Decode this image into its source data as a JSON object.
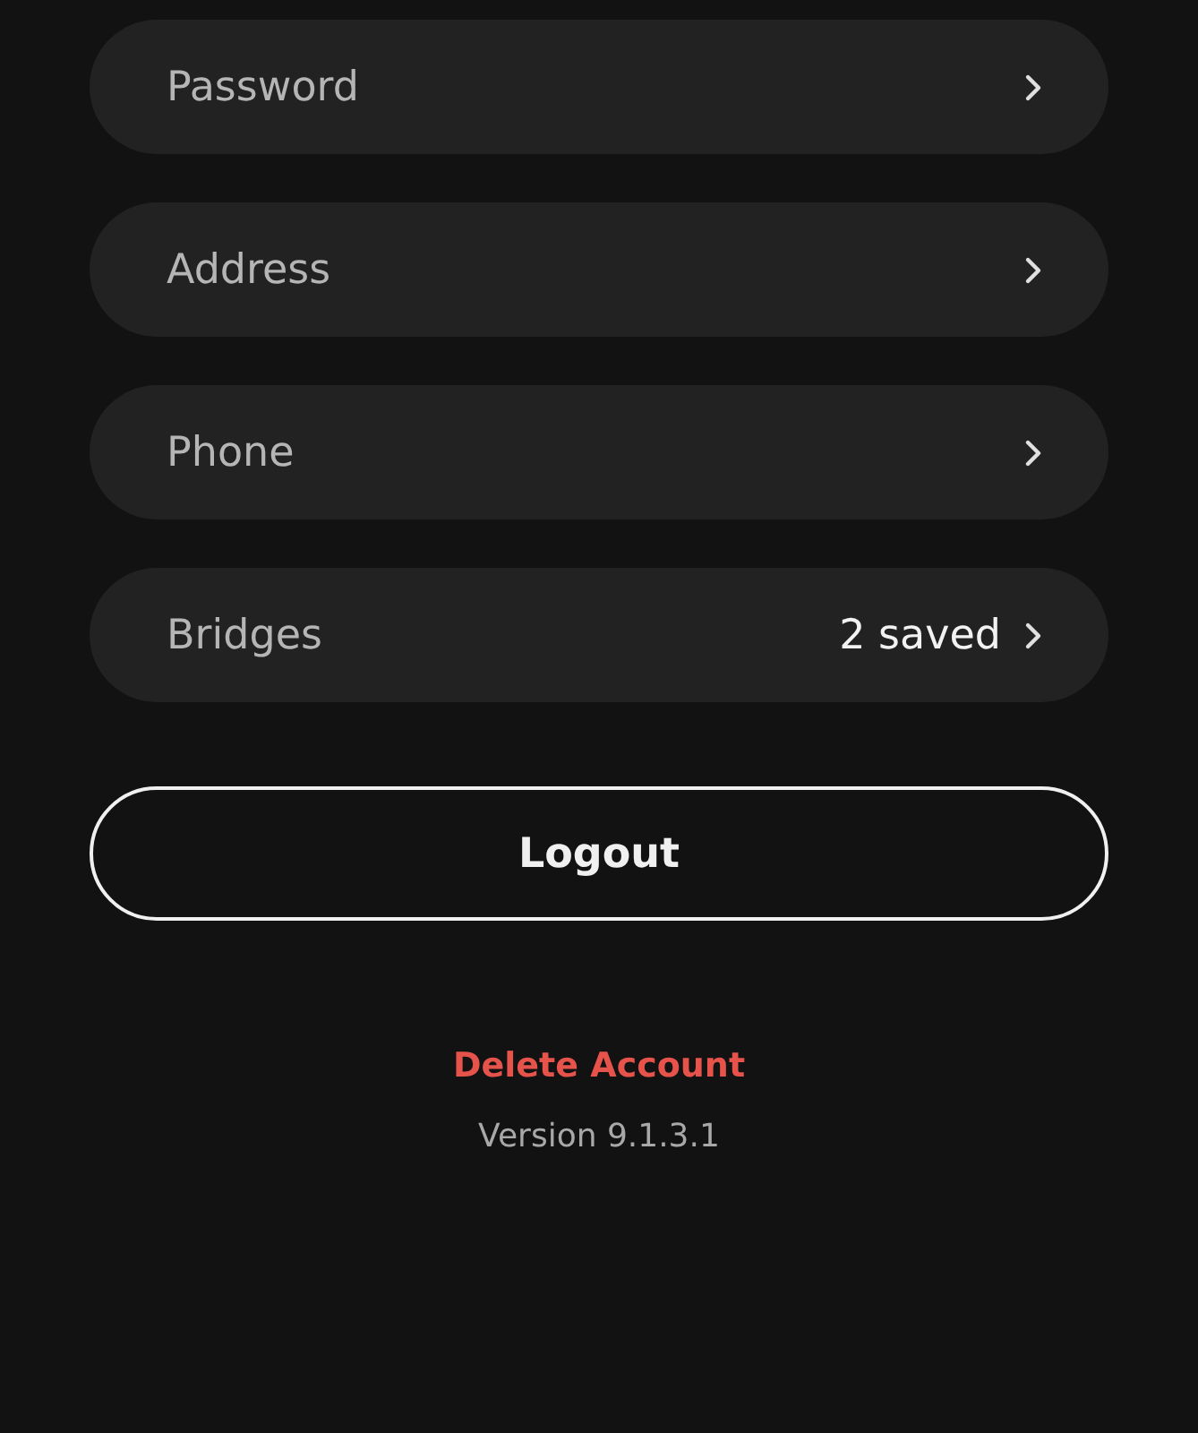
{
  "settings_rows": [
    {
      "label": "Password"
    },
    {
      "label": "Address"
    },
    {
      "label": "Phone"
    },
    {
      "label": "Bridges",
      "value": "2 saved"
    }
  ],
  "logout_button": "Logout",
  "delete_account_link": "Delete Account",
  "version": "Version 9.1.3.1"
}
